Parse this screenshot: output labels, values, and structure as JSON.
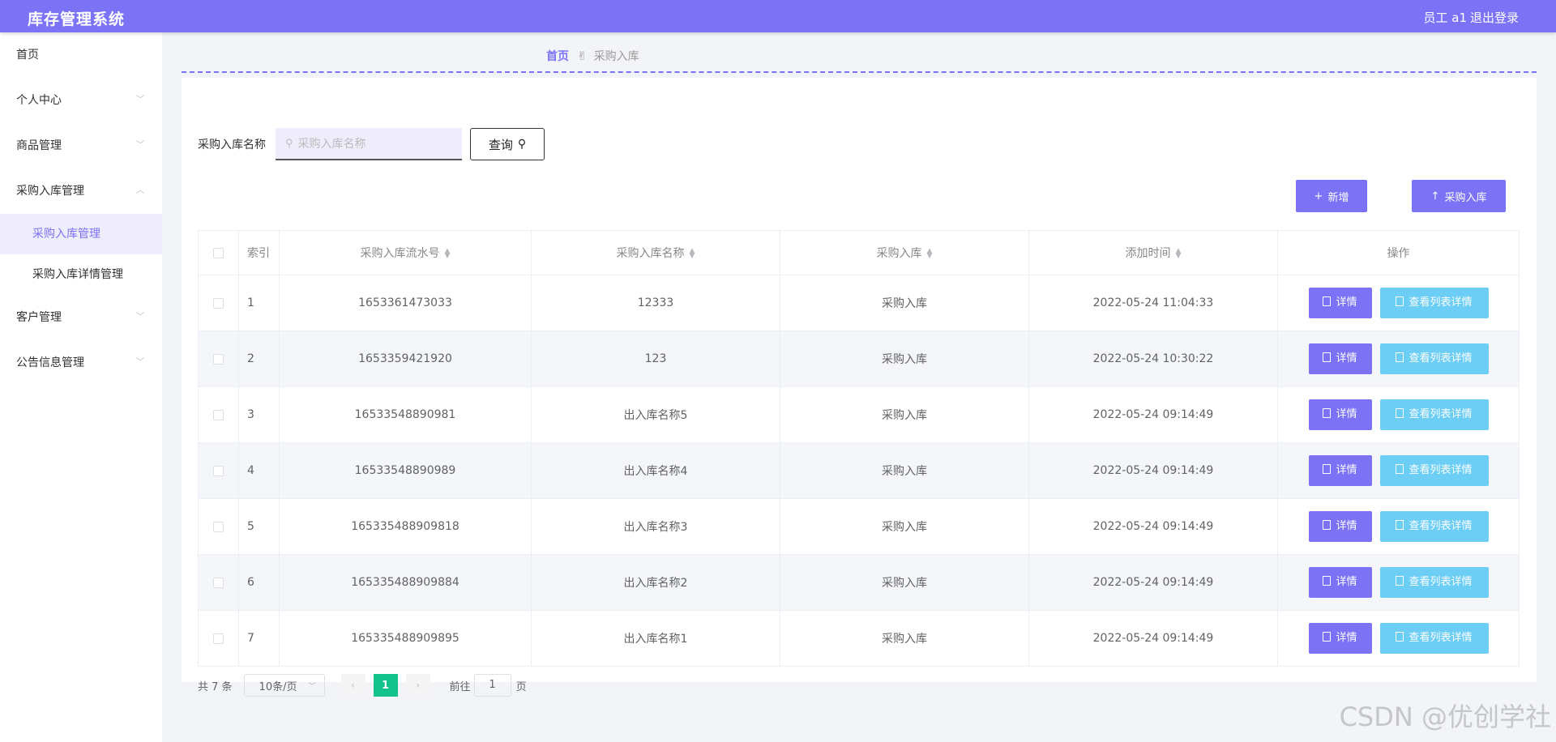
{
  "header": {
    "title": "库存管理系统",
    "user": "员工 a1",
    "logout": "退出登录"
  },
  "sidebar": {
    "items": [
      {
        "label": "首页"
      },
      {
        "label": "个人中心",
        "arrow": "﹀"
      },
      {
        "label": "商品管理",
        "arrow": "﹀"
      },
      {
        "label": "采购入库管理",
        "arrow": "︿"
      },
      {
        "label": "客户管理",
        "arrow": "﹀"
      },
      {
        "label": "公告信息管理",
        "arrow": "﹀"
      }
    ],
    "subitems": [
      {
        "label": "采购入库管理",
        "active": true
      },
      {
        "label": "采购入库详情管理",
        "active": false
      }
    ]
  },
  "breadcrumb": {
    "home": "首页",
    "sep_icon": "✌",
    "current": "采购入库"
  },
  "search": {
    "label": "采购入库名称",
    "placeholder": "采购入库名称",
    "button": "查询"
  },
  "actions": {
    "add": "新增",
    "import": "采购入库"
  },
  "table": {
    "columns": [
      "索引",
      "采购入库流水号",
      "采购入库名称",
      "采购入库",
      "添加时间",
      "操作"
    ],
    "op_detail": "详情",
    "op_list": "查看列表详情",
    "rows": [
      {
        "idx": "1",
        "serial": "1653361473033",
        "name": "12333",
        "type": "采购入库",
        "time": "2022-05-24 11:04:33"
      },
      {
        "idx": "2",
        "serial": "1653359421920",
        "name": "123",
        "type": "采购入库",
        "time": "2022-05-24 10:30:22"
      },
      {
        "idx": "3",
        "serial": "16533548890981",
        "name": "出入库名称5",
        "type": "采购入库",
        "time": "2022-05-24 09:14:49"
      },
      {
        "idx": "4",
        "serial": "16533548890989",
        "name": "出入库名称4",
        "type": "采购入库",
        "time": "2022-05-24 09:14:49"
      },
      {
        "idx": "5",
        "serial": "165335488909818",
        "name": "出入库名称3",
        "type": "采购入库",
        "time": "2022-05-24 09:14:49"
      },
      {
        "idx": "6",
        "serial": "165335488909884",
        "name": "出入库名称2",
        "type": "采购入库",
        "time": "2022-05-24 09:14:49"
      },
      {
        "idx": "7",
        "serial": "165335488909895",
        "name": "出入库名称1",
        "type": "采购入库",
        "time": "2022-05-24 09:14:49"
      }
    ]
  },
  "pagination": {
    "total": "共 7 条",
    "page_size": "10条/页",
    "current": "1",
    "goto_label": "前往",
    "goto_value": "1",
    "page_unit": "页"
  },
  "watermark": "CSDN @优创学社"
}
